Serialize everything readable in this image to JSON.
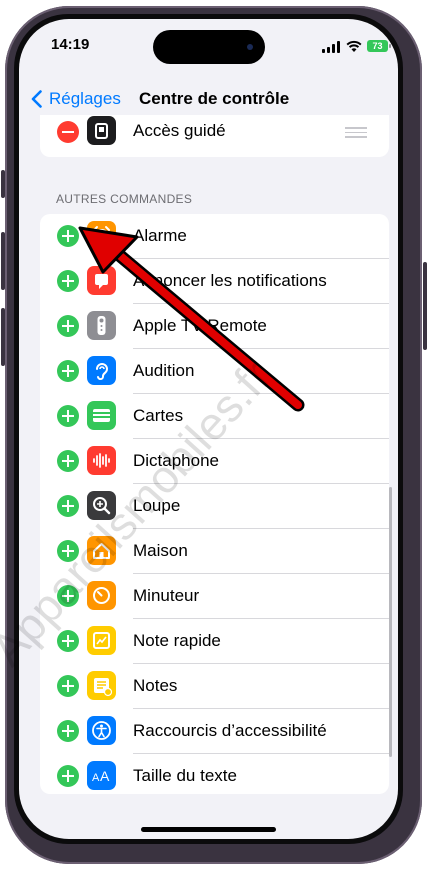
{
  "status_bar": {
    "time": "14:19",
    "battery": "73"
  },
  "navbar": {
    "back_label": "Réglages",
    "title": "Centre de contrôle"
  },
  "included_partial": {
    "label": "Accès guidé"
  },
  "section_header": "AUTRES COMMANDES",
  "items": [
    {
      "label": "Alarme",
      "icon": "alarm-icon",
      "color": "#ff9500"
    },
    {
      "label": "Annoncer les notifications",
      "icon": "announce-notifications-icon",
      "color": "#ff3b30"
    },
    {
      "label": "Apple TV Remote",
      "icon": "apple-tv-remote-icon",
      "color": "#8e8e93"
    },
    {
      "label": "Audition",
      "icon": "ear-icon",
      "color": "#007aff"
    },
    {
      "label": "Cartes",
      "icon": "wallet-icon",
      "color": "#34c759"
    },
    {
      "label": "Dictaphone",
      "icon": "voice-memos-icon",
      "color": "#ff3b30"
    },
    {
      "label": "Loupe",
      "icon": "magnifier-icon",
      "color": "#3a3a3c"
    },
    {
      "label": "Maison",
      "icon": "home-icon",
      "color": "#ff9500"
    },
    {
      "label": "Minuteur",
      "icon": "timer-icon",
      "color": "#ff9500"
    },
    {
      "label": "Note rapide",
      "icon": "quick-note-icon",
      "color": "#ffcc00"
    },
    {
      "label": "Notes",
      "icon": "notes-icon",
      "color": "#ffcc00"
    },
    {
      "label": "Raccourcis d’accessibilité",
      "icon": "accessibility-icon",
      "color": "#007aff"
    },
    {
      "label": "Taille du texte",
      "icon": "text-size-icon",
      "color": "#007aff"
    }
  ],
  "watermark": "Appareilsmobiles.fr",
  "colors": {
    "accent": "#007aff",
    "add": "#34c759",
    "remove": "#ff3b30",
    "annotation_arrow": "#e00000"
  }
}
